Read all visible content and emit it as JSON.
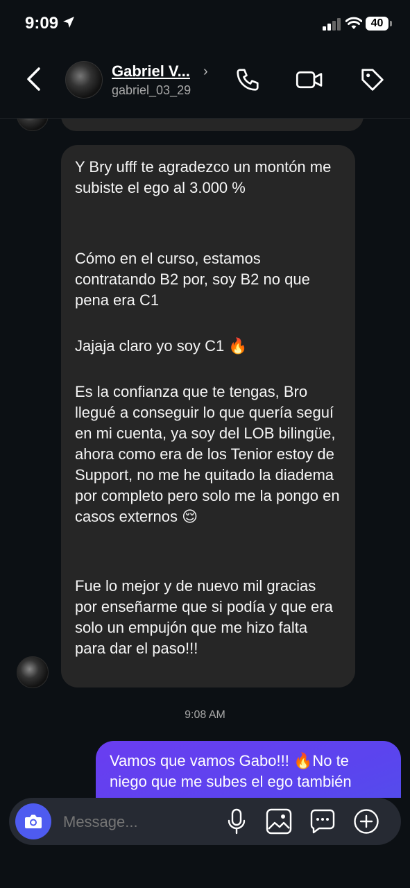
{
  "status_bar": {
    "time": "9:09",
    "battery": "40"
  },
  "header": {
    "contact_name": "Gabriel V...",
    "username": "gabriel_03_29"
  },
  "messages": {
    "incoming_paragraphs": [
      "Y Bry ufff te agradezco un montón me subiste el ego al 3.000 %",
      "Cómo en el curso, estamos contratando B2 por, soy B2 no que pena era C1",
      "Jajaja claro yo soy C1 🔥",
      "Es la confianza que te tengas, Bro llegué a conseguir lo que quería seguí en mi cuenta, ya soy del LOB bilingüe, ahora como era de los Tenior estoy de Support, no me he quitado la diadema por completo pero solo me la pongo en casos externos 😌",
      "Fue lo mejor y de nuevo mil gracias por enseñarme que si podía y que era solo un empujón que me hizo falta para dar el paso!!!"
    ],
    "timestamp": "9:08 AM",
    "outgoing": "Vamos que vamos Gabo!!! 🔥No te niego que me subes el ego también"
  },
  "composer": {
    "placeholder": "Message..."
  },
  "icons": {
    "back": "chevron-left-icon",
    "call": "phone-icon",
    "video": "video-icon",
    "tag": "tag-icon",
    "camera": "camera-icon",
    "mic": "microphone-icon",
    "gallery": "image-icon",
    "sticker": "chat-bubble-icon",
    "add": "plus-circle-icon"
  },
  "colors": {
    "background": "#0c1014",
    "incoming_bubble": "#262626",
    "outgoing_bubble": "#5b45ee",
    "accent": "#4e5bf0"
  }
}
